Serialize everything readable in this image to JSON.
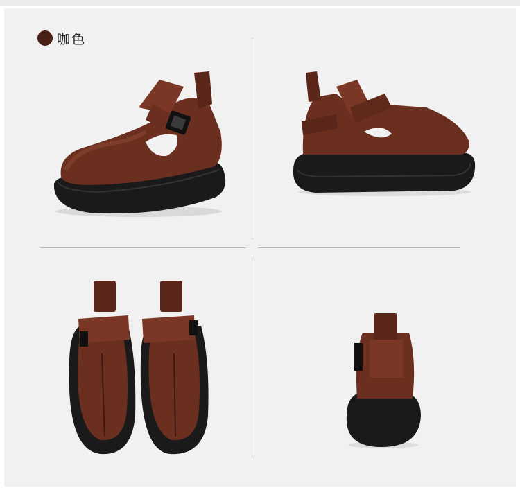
{
  "color_label": {
    "text": "咖色",
    "swatch_color": "#4a1f16"
  },
  "colors": {
    "leather": "#6b2f20",
    "leather_dark": "#3d1710",
    "leather_light": "#8a4633",
    "sole": "#1a1a1a",
    "background": "#f1f1f1"
  },
  "views": [
    {
      "name": "side-angle-view",
      "icon": "shoe-three-quarter-icon"
    },
    {
      "name": "side-profile-view",
      "icon": "shoe-side-icon"
    },
    {
      "name": "front-pair-view",
      "icon": "shoe-pair-front-icon"
    },
    {
      "name": "back-view",
      "icon": "shoe-back-icon"
    }
  ]
}
